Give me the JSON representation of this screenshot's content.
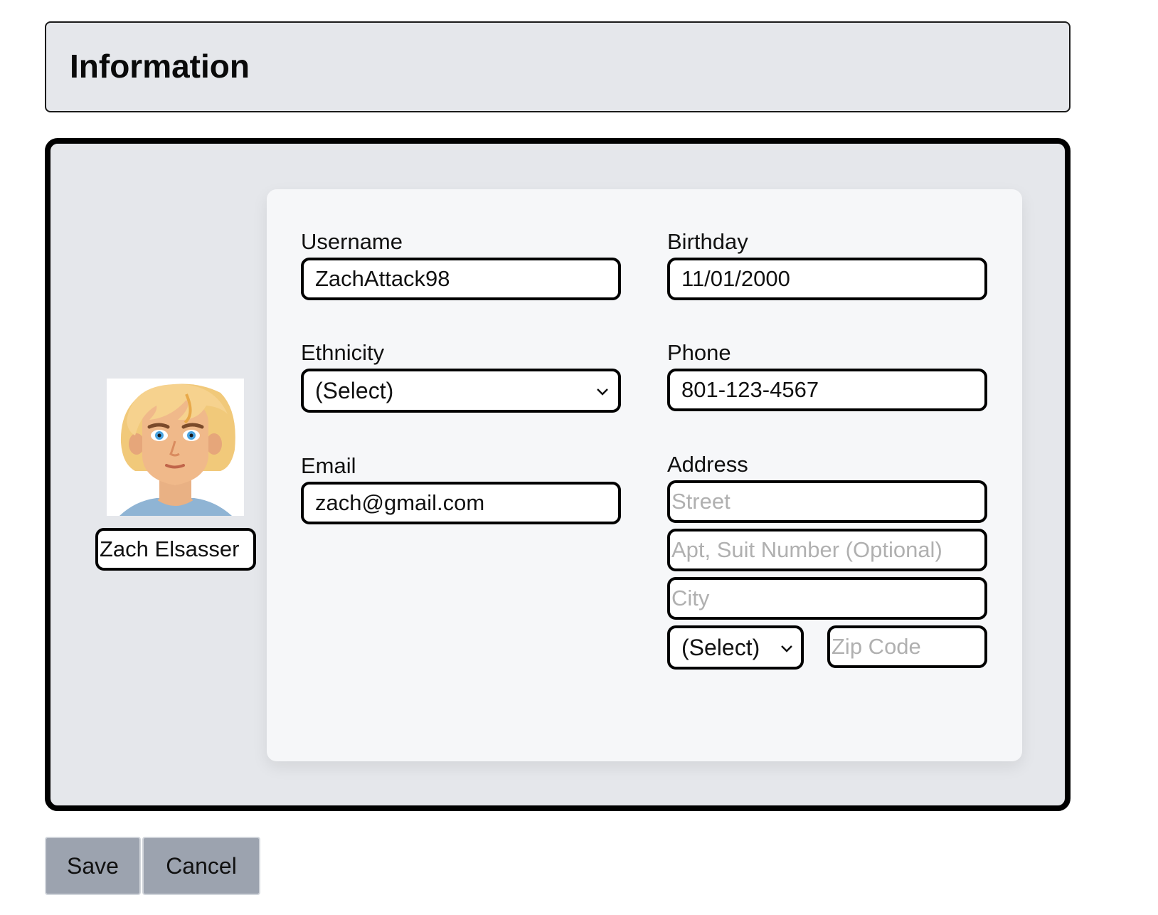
{
  "header": {
    "title": "Information"
  },
  "profile": {
    "name": "Zach Elsasser",
    "avatar_icon": "cartoon-avatar-portrait"
  },
  "form": {
    "username": {
      "label": "Username",
      "value": "ZachAttack98"
    },
    "birthday": {
      "label": "Birthday",
      "value": "11/01/2000"
    },
    "ethnicity": {
      "label": "Ethnicity",
      "selected": "(Select)"
    },
    "phone": {
      "label": "Phone",
      "value": "801-123-4567"
    },
    "email": {
      "label": "Email",
      "value": "zach@gmail.com"
    },
    "address": {
      "label": "Address",
      "street_placeholder": "Street",
      "apt_placeholder": "Apt, Suit Number (Optional)",
      "city_placeholder": "City",
      "state_selected": "(Select)",
      "zip_placeholder": "Zip Code"
    }
  },
  "actions": {
    "save_label": "Save",
    "cancel_label": "Cancel"
  },
  "colors": {
    "header_bg": "#e5e7eb",
    "panel_bg": "#e5e7eb",
    "card_bg": "#f6f7f9",
    "button_bg": "#9ca3af",
    "placeholder": "#b0b0b0"
  }
}
